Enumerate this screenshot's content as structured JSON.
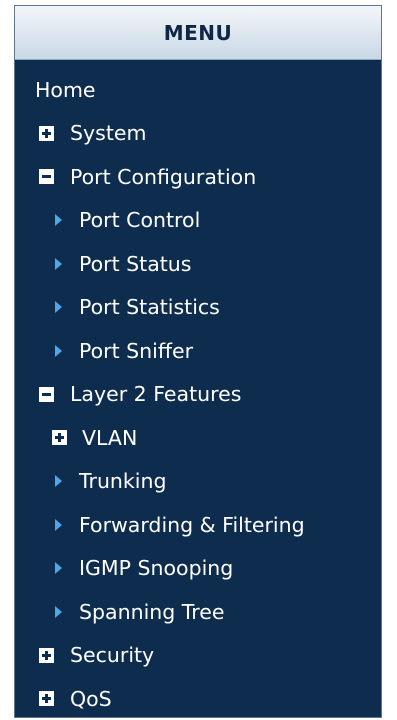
{
  "menu": {
    "title": "MENU",
    "home": "Home",
    "system": "System",
    "port_configuration": {
      "label": "Port Configuration",
      "items": [
        "Port Control",
        "Port Status",
        "Port Statistics",
        "Port Sniffer"
      ]
    },
    "layer2": {
      "label": "Layer 2 Features",
      "vlan": "VLAN",
      "items": [
        "Trunking",
        "Forwarding & Filtering",
        "IGMP Snooping",
        "Spanning Tree"
      ]
    },
    "security": "Security",
    "qos": "QoS"
  },
  "icons": {
    "expanded": "minus-box-icon",
    "collapsed": "plus-box-icon",
    "leaf": "triangle-arrow-icon"
  },
  "colors": {
    "background": "#0e2d4e",
    "text": "#ffffff",
    "arrow": "#4fa6e8",
    "header_text": "#0f2744"
  }
}
